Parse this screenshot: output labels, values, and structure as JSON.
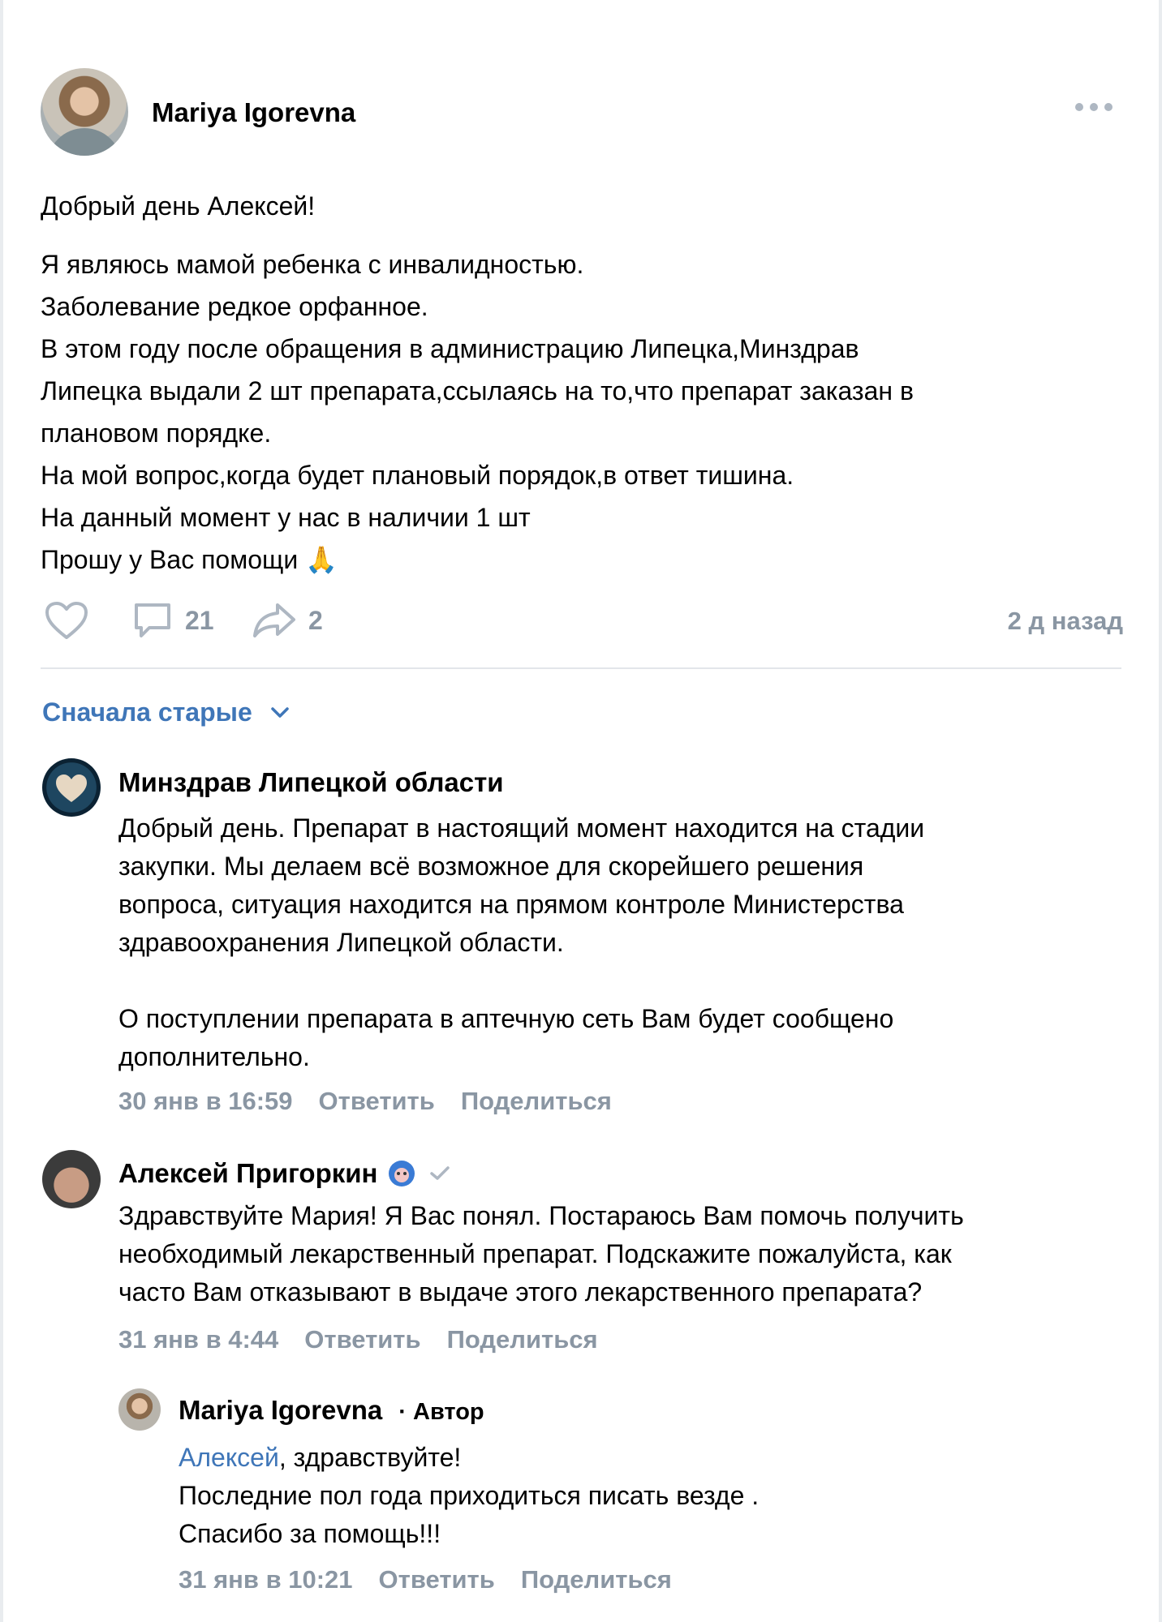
{
  "post": {
    "author": "Mariya Igorevna",
    "greeting": "Добрый день Алексей!",
    "lines": [
      "Я являюсь мамой ребенка с инвалидностью.",
      "Заболевание редкое орфанное.",
      "В этом году после обращения в администрацию Липецка,Минздрав",
      "Липецка выдали 2 шт препарата,ссылаясь на то,что препарат заказан в",
      "плановом порядке.",
      "На мой вопрос,когда будет плановый порядок,в ответ тишина.",
      "На данный момент у нас в наличии 1 шт",
      "Прошу у Вас помощи 🙏"
    ],
    "comments_count": "21",
    "shares_count": "2",
    "time_ago": "2 д назад"
  },
  "sort": {
    "label": "Сначала старые"
  },
  "comments": [
    {
      "author": "Минздрав Липецкой области",
      "lines_1": [
        "Добрый день. Препарат в настоящий момент находится на стадии",
        "закупки. Мы делаем всё возможное для скорейшего решения",
        "вопроса, ситуация находится на прямом контроле Министерства",
        "здравоохранения Липецкой области."
      ],
      "lines_2": [
        "О поступлении препарата в аптечную сеть Вам будет сообщено",
        "дополнительно."
      ],
      "date": "30 янв в 16:59",
      "reply_label": "Ответить",
      "share_label": "Поделиться"
    },
    {
      "author": "Алексей Пригоркин",
      "lines": [
        "Здравствуйте Мария! Я Вас понял. Постараюсь Вам помочь получить",
        "необходимый лекарственный препарат. Подскажите пожалуйста, как",
        "часто Вам отказывают в выдаче этого лекарственного препарата?"
      ],
      "date": "31 янв в 4:44",
      "reply_label": "Ответить",
      "share_label": "Поделиться"
    },
    {
      "author": "Mariya Igorevna",
      "author_tag": "· Автор",
      "mention": "Алексей",
      "first_line_rest": ", здравствуйте!",
      "lines": [
        "Последние пол года приходиться писать везде .",
        "Спасибо за помощь!!!"
      ],
      "date": "31 янв в 10:21",
      "reply_label": "Ответить",
      "share_label": "Поделиться"
    }
  ],
  "colors": {
    "link": "#3f76b8",
    "muted": "#8a96a3",
    "icon": "#aeb7c2"
  }
}
